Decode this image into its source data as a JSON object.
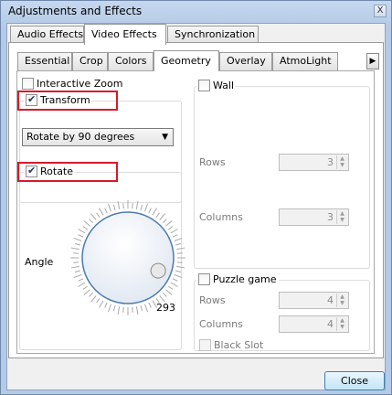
{
  "window": {
    "title": "Adjustments and Effects",
    "close_glyph": "X"
  },
  "top_tabs": [
    {
      "label": "Audio Effects",
      "active": false
    },
    {
      "label": "Video Effects",
      "active": true
    },
    {
      "label": "Synchronization",
      "active": false
    }
  ],
  "sub_tabs": [
    {
      "label": "Essential",
      "active": false
    },
    {
      "label": "Crop",
      "active": false
    },
    {
      "label": "Colors",
      "active": false
    },
    {
      "label": "Geometry",
      "active": true
    },
    {
      "label": "Overlay",
      "active": false
    },
    {
      "label": "AtmoLight",
      "active": false
    }
  ],
  "sub_tabs_scroll_glyph": "▶",
  "geometry": {
    "interactive_zoom": {
      "label": "Interactive Zoom",
      "checked": false
    },
    "transform": {
      "label": "Transform",
      "checked": true
    },
    "transform_select": {
      "value": "Rotate by 90 degrees",
      "glyph": "▼"
    },
    "rotate": {
      "label": "Rotate",
      "checked": true
    },
    "angle": {
      "label": "Angle",
      "value": "293"
    },
    "wall": {
      "label": "Wall",
      "checked": false,
      "rows_label": "Rows",
      "rows_value": "3",
      "columns_label": "Columns",
      "columns_value": "3"
    },
    "puzzle": {
      "label": "Puzzle game",
      "checked": false,
      "rows_label": "Rows",
      "rows_value": "4",
      "columns_label": "Columns",
      "columns_value": "4",
      "black_slot_label": "Black Slot"
    }
  },
  "buttons": {
    "close": "Close"
  },
  "colors": {
    "highlight": "#d51b2a",
    "accent": "#3c7fb1"
  }
}
